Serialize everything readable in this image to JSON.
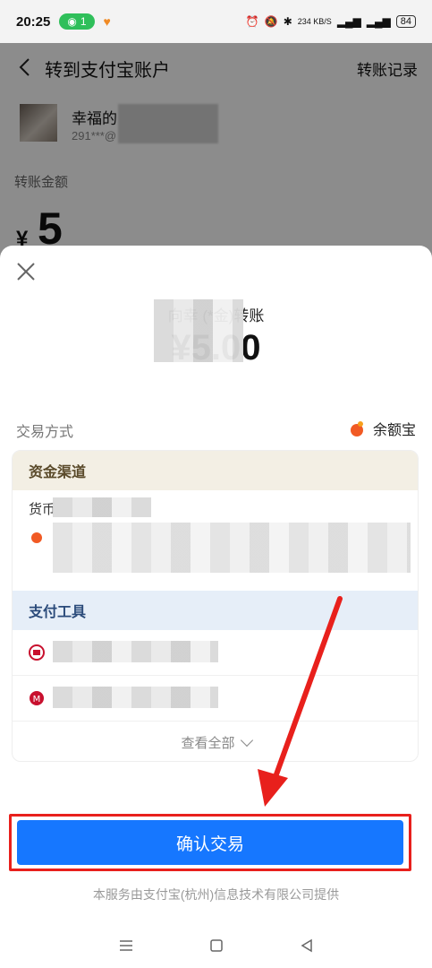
{
  "status_bar": {
    "time": "20:25",
    "wifi_count": "1",
    "battery": "84",
    "network_speed": "234 KB/S"
  },
  "header": {
    "title": "转到支付宝账户",
    "right_link": "转账记录"
  },
  "payee": {
    "name": "幸福的",
    "account": "291***@"
  },
  "transfer": {
    "amount_label": "转账金额",
    "currency": "¥",
    "amount": "5"
  },
  "modal": {
    "recipient_text": "向幸          (*金)转账",
    "amount": "¥5.00",
    "method_label": "交易方式",
    "method_value": "余额宝",
    "fund_channel_label": "资金渠道",
    "fund_sub_label": "货币",
    "payment_tools_label": "支付工具",
    "view_all": "查看全部",
    "confirm_button": "确认交易",
    "footer_note": "本服务由支付宝(杭州)信息技术有限公司提供"
  },
  "colors": {
    "accent_blue": "#1677ff",
    "highlight_red": "#e8201c"
  }
}
